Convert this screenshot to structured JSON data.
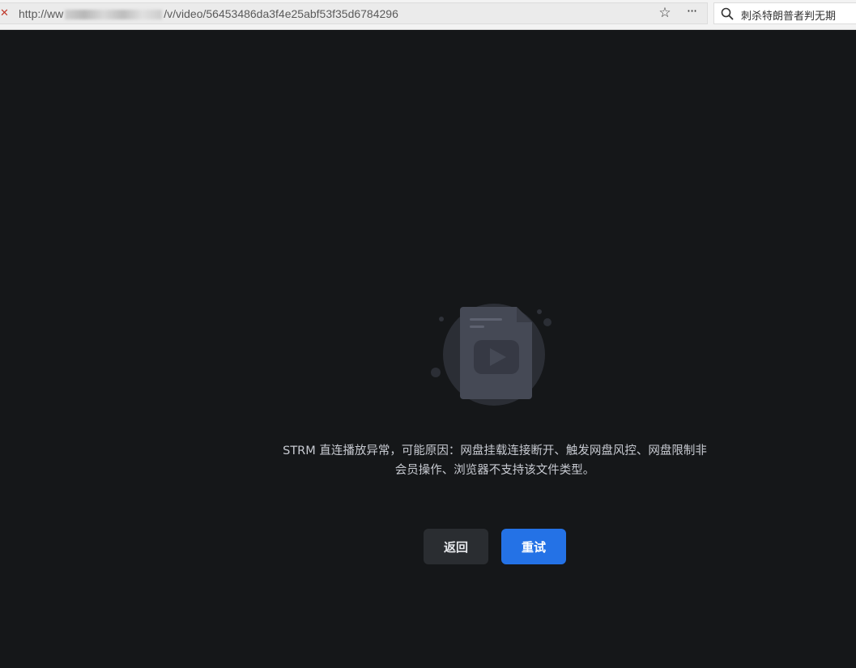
{
  "browser": {
    "url_prefix": "http://ww",
    "url_suffix": "/v/video/56453486da3f4e25abf53f35d6784296",
    "search_text": "刺杀特朗普者判无期"
  },
  "player": {
    "error_line1": "STRM 直连播放异常，可能原因：网盘挂载连接断开、触发网盘风控、网盘限制非",
    "error_line2": "会员操作、浏览器不支持该文件类型。",
    "back_label": "返回",
    "retry_label": "重试"
  },
  "colors": {
    "background": "#151719",
    "retry_button": "#2472e6",
    "back_button": "#2a2d31"
  },
  "icons": [
    "star-icon",
    "more-icon",
    "search-icon",
    "video-file-icon"
  ]
}
